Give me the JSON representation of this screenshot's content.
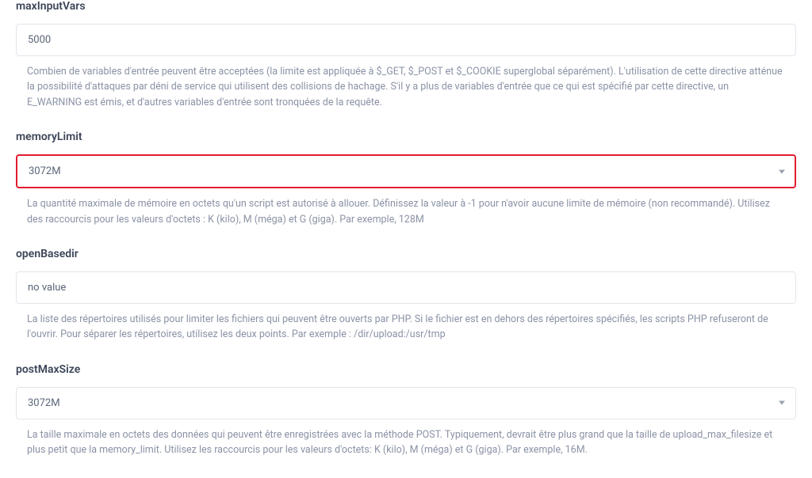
{
  "fields": {
    "maxInputVars": {
      "label": "maxInputVars",
      "value": "5000",
      "description": "Combien de variables d'entrée peuvent être acceptées (la limite est appliquée à $_GET, $_POST et $_COOKIE superglobal séparément). L'utilisation de cette directive atténue la possibilité d'attaques par déni de service qui utilisent des collisions de hachage. S'il y a plus de variables d'entrée que ce qui est spécifié par cette directive, un E_WARNING est émis, et d'autres variables d'entrée sont tronquées de la requête."
    },
    "memoryLimit": {
      "label": "memoryLimit",
      "value": "3072M",
      "description": "La quantité maximale de mémoire en octets qu'un script est autorisé à allouer. Définissez la valeur à -1 pour n'avoir aucune limite de mémoire (non recommandé). Utilisez des raccourcis pour les valeurs d'octets : K (kilo), M (méga) et G (giga). Par exemple, 128M"
    },
    "openBasedir": {
      "label": "openBasedir",
      "value": "no value",
      "description": "La liste des répertoires utilisés pour limiter les fichiers qui peuvent être ouverts par PHP. Si le fichier est en dehors des répertoires spécifiés, les scripts PHP refuseront de l'ouvrir. Pour séparer les répertoires, utilisez les deux points. Par exemple : /dir/upload:/usr/tmp"
    },
    "postMaxSize": {
      "label": "postMaxSize",
      "value": "3072M",
      "description": "La taille maximale en octets des données qui peuvent être enregistrées avec la méthode POST. Typiquement, devrait être plus grand que la taille de upload_max_filesize et plus petit que la memory_limit. Utilisez les raccourcis pour les valeurs d'octets: K (kilo), M (méga) et G (giga). Par exemple, 16M."
    }
  }
}
